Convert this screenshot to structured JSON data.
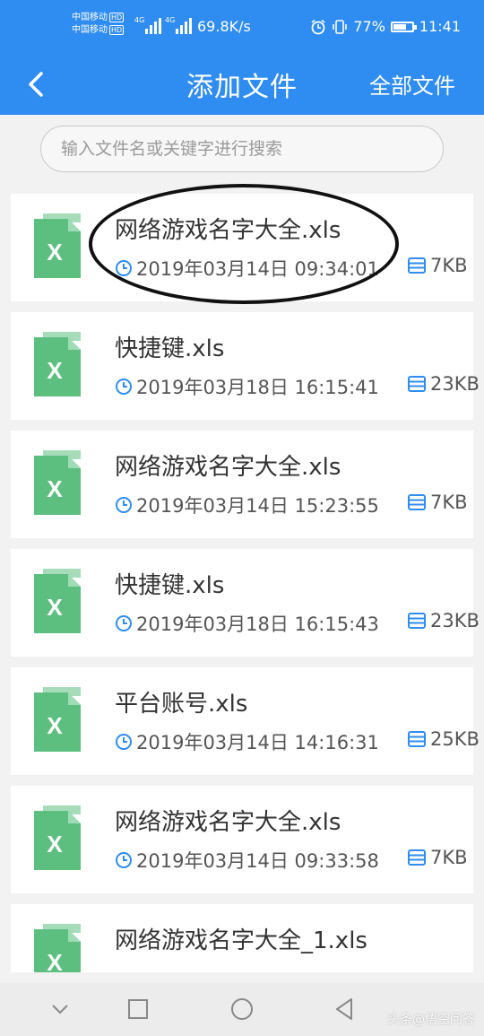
{
  "status_bar": {
    "carrier_1": "中国移动",
    "carrier_2": "中国移动",
    "hd": "HD",
    "net_1": "4G",
    "net_2": "4G",
    "speed": "69.8K/s",
    "battery": "77%",
    "battery_level": 0.77,
    "time": "11:41"
  },
  "header": {
    "title": "添加文件",
    "right_action": "全部文件"
  },
  "search": {
    "placeholder": "输入文件名或关键字进行搜索"
  },
  "files": [
    {
      "name": "网络游戏名字大全.xls",
      "time": "2019年03月14日 09:34:01",
      "size": "7KB"
    },
    {
      "name": "快捷键.xls",
      "time": "2019年03月18日 16:15:41",
      "size": "23KB"
    },
    {
      "name": "网络游戏名字大全.xls",
      "time": "2019年03月14日 15:23:55",
      "size": "7KB"
    },
    {
      "name": "快捷键.xls",
      "time": "2019年03月18日 16:15:43",
      "size": "23KB"
    },
    {
      "name": "平台账号.xls",
      "time": "2019年03月14日 14:16:31",
      "size": "25KB"
    },
    {
      "name": "网络游戏名字大全.xls",
      "time": "2019年03月14日 09:33:58",
      "size": "7KB"
    },
    {
      "name": "网络游戏名字大全_1.xls",
      "time": "",
      "size": ""
    }
  ],
  "icons": {
    "file": "excel-file-icon",
    "time": "clock-icon",
    "size": "storage-icon"
  },
  "colors": {
    "header": "#2f8cf0",
    "excel": "#5cbf7f",
    "meta_icon": "#2f8cf0"
  },
  "watermark": "头条@悟空问答"
}
